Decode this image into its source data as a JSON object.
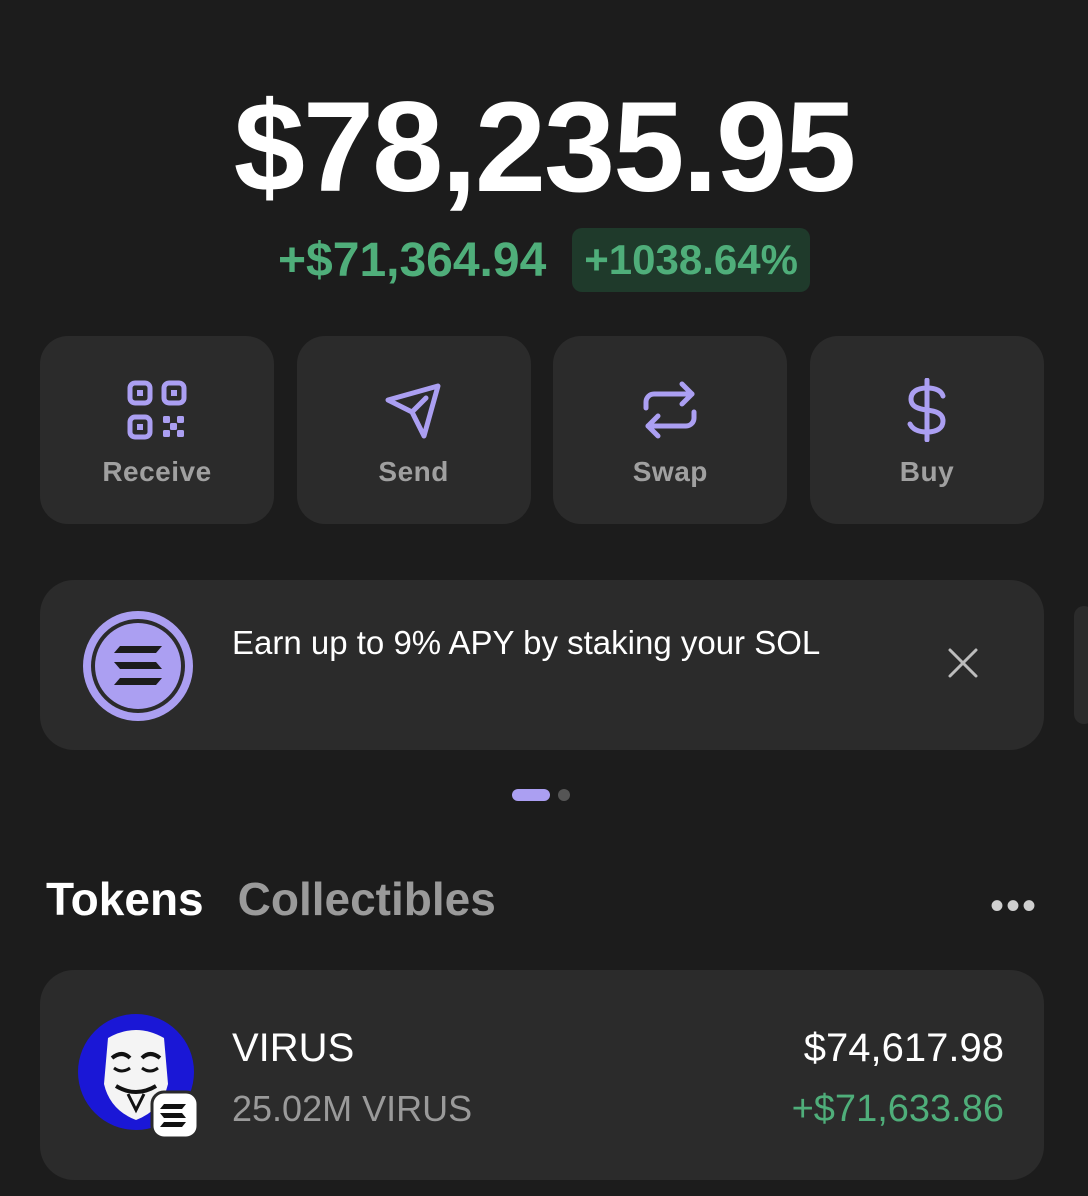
{
  "portfolio": {
    "balance": "$78,235.95",
    "change_amount": "+$71,364.94",
    "change_percent": "+1038.64%"
  },
  "actions": [
    {
      "label": "Receive",
      "icon": "qr-code-icon"
    },
    {
      "label": "Send",
      "icon": "send-icon"
    },
    {
      "label": "Swap",
      "icon": "swap-icon"
    },
    {
      "label": "Buy",
      "icon": "dollar-icon"
    }
  ],
  "banner": {
    "text": "Earn up to 9% APY by staking your SOL",
    "icon": "solana-logo-icon",
    "close_icon": "close-icon"
  },
  "pager": {
    "total": 2,
    "active": 1
  },
  "tabs": {
    "tokens": "Tokens",
    "collectibles": "Collectibles",
    "more_icon": "more-icon",
    "more_glyph": "•••"
  },
  "tokens": [
    {
      "name": "VIRUS",
      "amount": "25.02M VIRUS",
      "value": "$74,617.98",
      "change": "+$71,633.86",
      "icon": "virus-token-avatar",
      "chain_badge": "solana-badge-icon"
    }
  ],
  "colors": {
    "background": "#1c1c1c",
    "card": "#2b2b2b",
    "accent": "#ab9ff2",
    "positive": "#4fae7a",
    "positive_bg": "#1f3a2b",
    "muted": "#9a9a9a"
  }
}
